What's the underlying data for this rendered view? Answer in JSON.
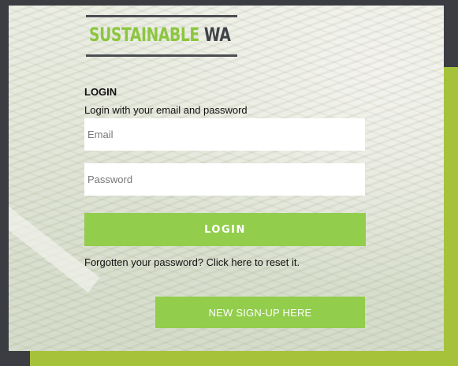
{
  "brand": {
    "logo_part1": "SUSTAINABLE",
    "logo_part2": "WA"
  },
  "login": {
    "title": "LOGIN",
    "subtitle": "Login with your email and password",
    "email_placeholder": "Email",
    "password_placeholder": "Password",
    "submit_label": "LOGIN",
    "forgot_text": "Forgotten your password? Click here to reset it."
  },
  "signup": {
    "label": "NEW SIGN-UP HERE"
  },
  "colors": {
    "accent_green": "#92cd4c",
    "frame_olive": "#a6c23a",
    "background_dark": "#3b3d42"
  }
}
